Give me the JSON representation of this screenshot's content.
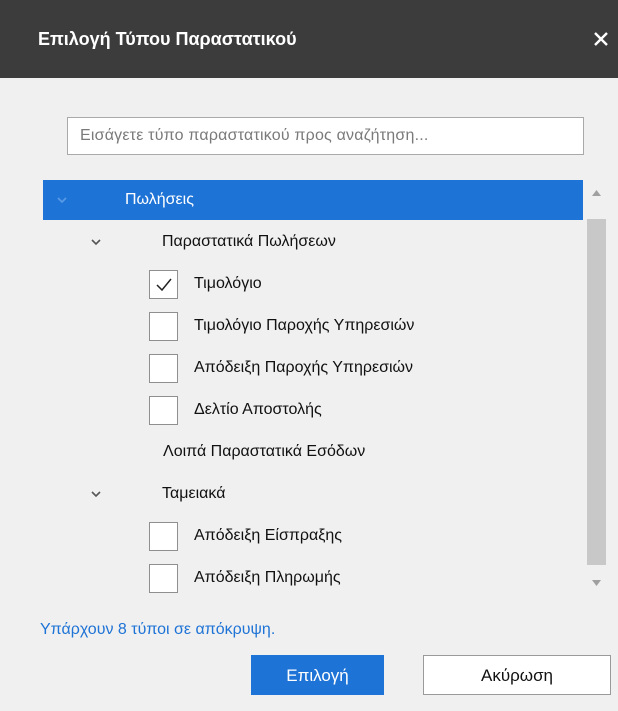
{
  "dialog": {
    "title": "Επιλογή Τύπου Παραστατικού",
    "close_label": "✕"
  },
  "search": {
    "placeholder": "Εισάγετε τύπο παραστατικού προς αναζήτηση...",
    "value": ""
  },
  "tree": {
    "sales": {
      "label": "Πωλήσεις",
      "expanded": true,
      "selected": true
    },
    "sales_docs": {
      "label": "Παραστατικά Πωλήσεων",
      "expanded": true
    },
    "invoice": {
      "label": "Τιμολόγιο",
      "checked": true
    },
    "service_invoice": {
      "label": "Τιμολόγιο Παροχής Υπηρεσιών",
      "checked": false
    },
    "service_receipt": {
      "label": "Απόδειξη Παροχής Υπηρεσιών",
      "checked": false
    },
    "delivery_note": {
      "label": "Δελτίο Αποστολής",
      "checked": false
    },
    "other_income": {
      "label": "Λοιπά Παραστατικά Εσόδων"
    },
    "cash": {
      "label": "Ταμειακά",
      "expanded": true
    },
    "collection_receipt": {
      "label": "Απόδειξη Είσπραξης",
      "checked": false
    },
    "payment_receipt": {
      "label": "Απόδειξη Πληρωμής",
      "checked": false
    }
  },
  "hidden_note": "Υπάρχουν 8 τύποι σε απόκρυψη.",
  "buttons": {
    "select": "Επιλογή",
    "cancel": "Ακύρωση"
  },
  "colors": {
    "accent": "#1e73d6",
    "titlebar": "#3c3c3c",
    "background": "#f0f0f0"
  }
}
